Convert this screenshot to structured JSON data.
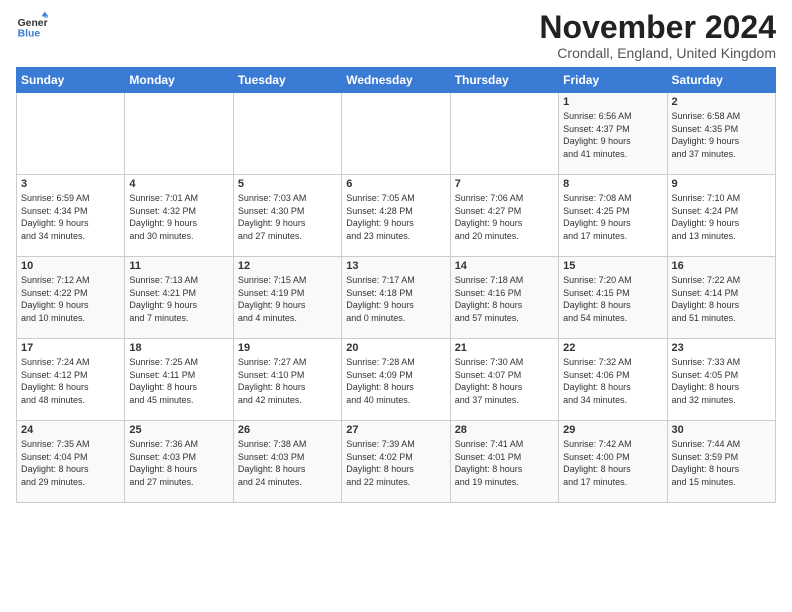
{
  "logo": {
    "line1": "General",
    "line2": "Blue"
  },
  "title": "November 2024",
  "location": "Crondall, England, United Kingdom",
  "weekdays": [
    "Sunday",
    "Monday",
    "Tuesday",
    "Wednesday",
    "Thursday",
    "Friday",
    "Saturday"
  ],
  "weeks": [
    [
      {
        "day": "",
        "info": ""
      },
      {
        "day": "",
        "info": ""
      },
      {
        "day": "",
        "info": ""
      },
      {
        "day": "",
        "info": ""
      },
      {
        "day": "",
        "info": ""
      },
      {
        "day": "1",
        "info": "Sunrise: 6:56 AM\nSunset: 4:37 PM\nDaylight: 9 hours\nand 41 minutes."
      },
      {
        "day": "2",
        "info": "Sunrise: 6:58 AM\nSunset: 4:35 PM\nDaylight: 9 hours\nand 37 minutes."
      }
    ],
    [
      {
        "day": "3",
        "info": "Sunrise: 6:59 AM\nSunset: 4:34 PM\nDaylight: 9 hours\nand 34 minutes."
      },
      {
        "day": "4",
        "info": "Sunrise: 7:01 AM\nSunset: 4:32 PM\nDaylight: 9 hours\nand 30 minutes."
      },
      {
        "day": "5",
        "info": "Sunrise: 7:03 AM\nSunset: 4:30 PM\nDaylight: 9 hours\nand 27 minutes."
      },
      {
        "day": "6",
        "info": "Sunrise: 7:05 AM\nSunset: 4:28 PM\nDaylight: 9 hours\nand 23 minutes."
      },
      {
        "day": "7",
        "info": "Sunrise: 7:06 AM\nSunset: 4:27 PM\nDaylight: 9 hours\nand 20 minutes."
      },
      {
        "day": "8",
        "info": "Sunrise: 7:08 AM\nSunset: 4:25 PM\nDaylight: 9 hours\nand 17 minutes."
      },
      {
        "day": "9",
        "info": "Sunrise: 7:10 AM\nSunset: 4:24 PM\nDaylight: 9 hours\nand 13 minutes."
      }
    ],
    [
      {
        "day": "10",
        "info": "Sunrise: 7:12 AM\nSunset: 4:22 PM\nDaylight: 9 hours\nand 10 minutes."
      },
      {
        "day": "11",
        "info": "Sunrise: 7:13 AM\nSunset: 4:21 PM\nDaylight: 9 hours\nand 7 minutes."
      },
      {
        "day": "12",
        "info": "Sunrise: 7:15 AM\nSunset: 4:19 PM\nDaylight: 9 hours\nand 4 minutes."
      },
      {
        "day": "13",
        "info": "Sunrise: 7:17 AM\nSunset: 4:18 PM\nDaylight: 9 hours\nand 0 minutes."
      },
      {
        "day": "14",
        "info": "Sunrise: 7:18 AM\nSunset: 4:16 PM\nDaylight: 8 hours\nand 57 minutes."
      },
      {
        "day": "15",
        "info": "Sunrise: 7:20 AM\nSunset: 4:15 PM\nDaylight: 8 hours\nand 54 minutes."
      },
      {
        "day": "16",
        "info": "Sunrise: 7:22 AM\nSunset: 4:14 PM\nDaylight: 8 hours\nand 51 minutes."
      }
    ],
    [
      {
        "day": "17",
        "info": "Sunrise: 7:24 AM\nSunset: 4:12 PM\nDaylight: 8 hours\nand 48 minutes."
      },
      {
        "day": "18",
        "info": "Sunrise: 7:25 AM\nSunset: 4:11 PM\nDaylight: 8 hours\nand 45 minutes."
      },
      {
        "day": "19",
        "info": "Sunrise: 7:27 AM\nSunset: 4:10 PM\nDaylight: 8 hours\nand 42 minutes."
      },
      {
        "day": "20",
        "info": "Sunrise: 7:28 AM\nSunset: 4:09 PM\nDaylight: 8 hours\nand 40 minutes."
      },
      {
        "day": "21",
        "info": "Sunrise: 7:30 AM\nSunset: 4:07 PM\nDaylight: 8 hours\nand 37 minutes."
      },
      {
        "day": "22",
        "info": "Sunrise: 7:32 AM\nSunset: 4:06 PM\nDaylight: 8 hours\nand 34 minutes."
      },
      {
        "day": "23",
        "info": "Sunrise: 7:33 AM\nSunset: 4:05 PM\nDaylight: 8 hours\nand 32 minutes."
      }
    ],
    [
      {
        "day": "24",
        "info": "Sunrise: 7:35 AM\nSunset: 4:04 PM\nDaylight: 8 hours\nand 29 minutes."
      },
      {
        "day": "25",
        "info": "Sunrise: 7:36 AM\nSunset: 4:03 PM\nDaylight: 8 hours\nand 27 minutes."
      },
      {
        "day": "26",
        "info": "Sunrise: 7:38 AM\nSunset: 4:03 PM\nDaylight: 8 hours\nand 24 minutes."
      },
      {
        "day": "27",
        "info": "Sunrise: 7:39 AM\nSunset: 4:02 PM\nDaylight: 8 hours\nand 22 minutes."
      },
      {
        "day": "28",
        "info": "Sunrise: 7:41 AM\nSunset: 4:01 PM\nDaylight: 8 hours\nand 19 minutes."
      },
      {
        "day": "29",
        "info": "Sunrise: 7:42 AM\nSunset: 4:00 PM\nDaylight: 8 hours\nand 17 minutes."
      },
      {
        "day": "30",
        "info": "Sunrise: 7:44 AM\nSunset: 3:59 PM\nDaylight: 8 hours\nand 15 minutes."
      }
    ]
  ]
}
